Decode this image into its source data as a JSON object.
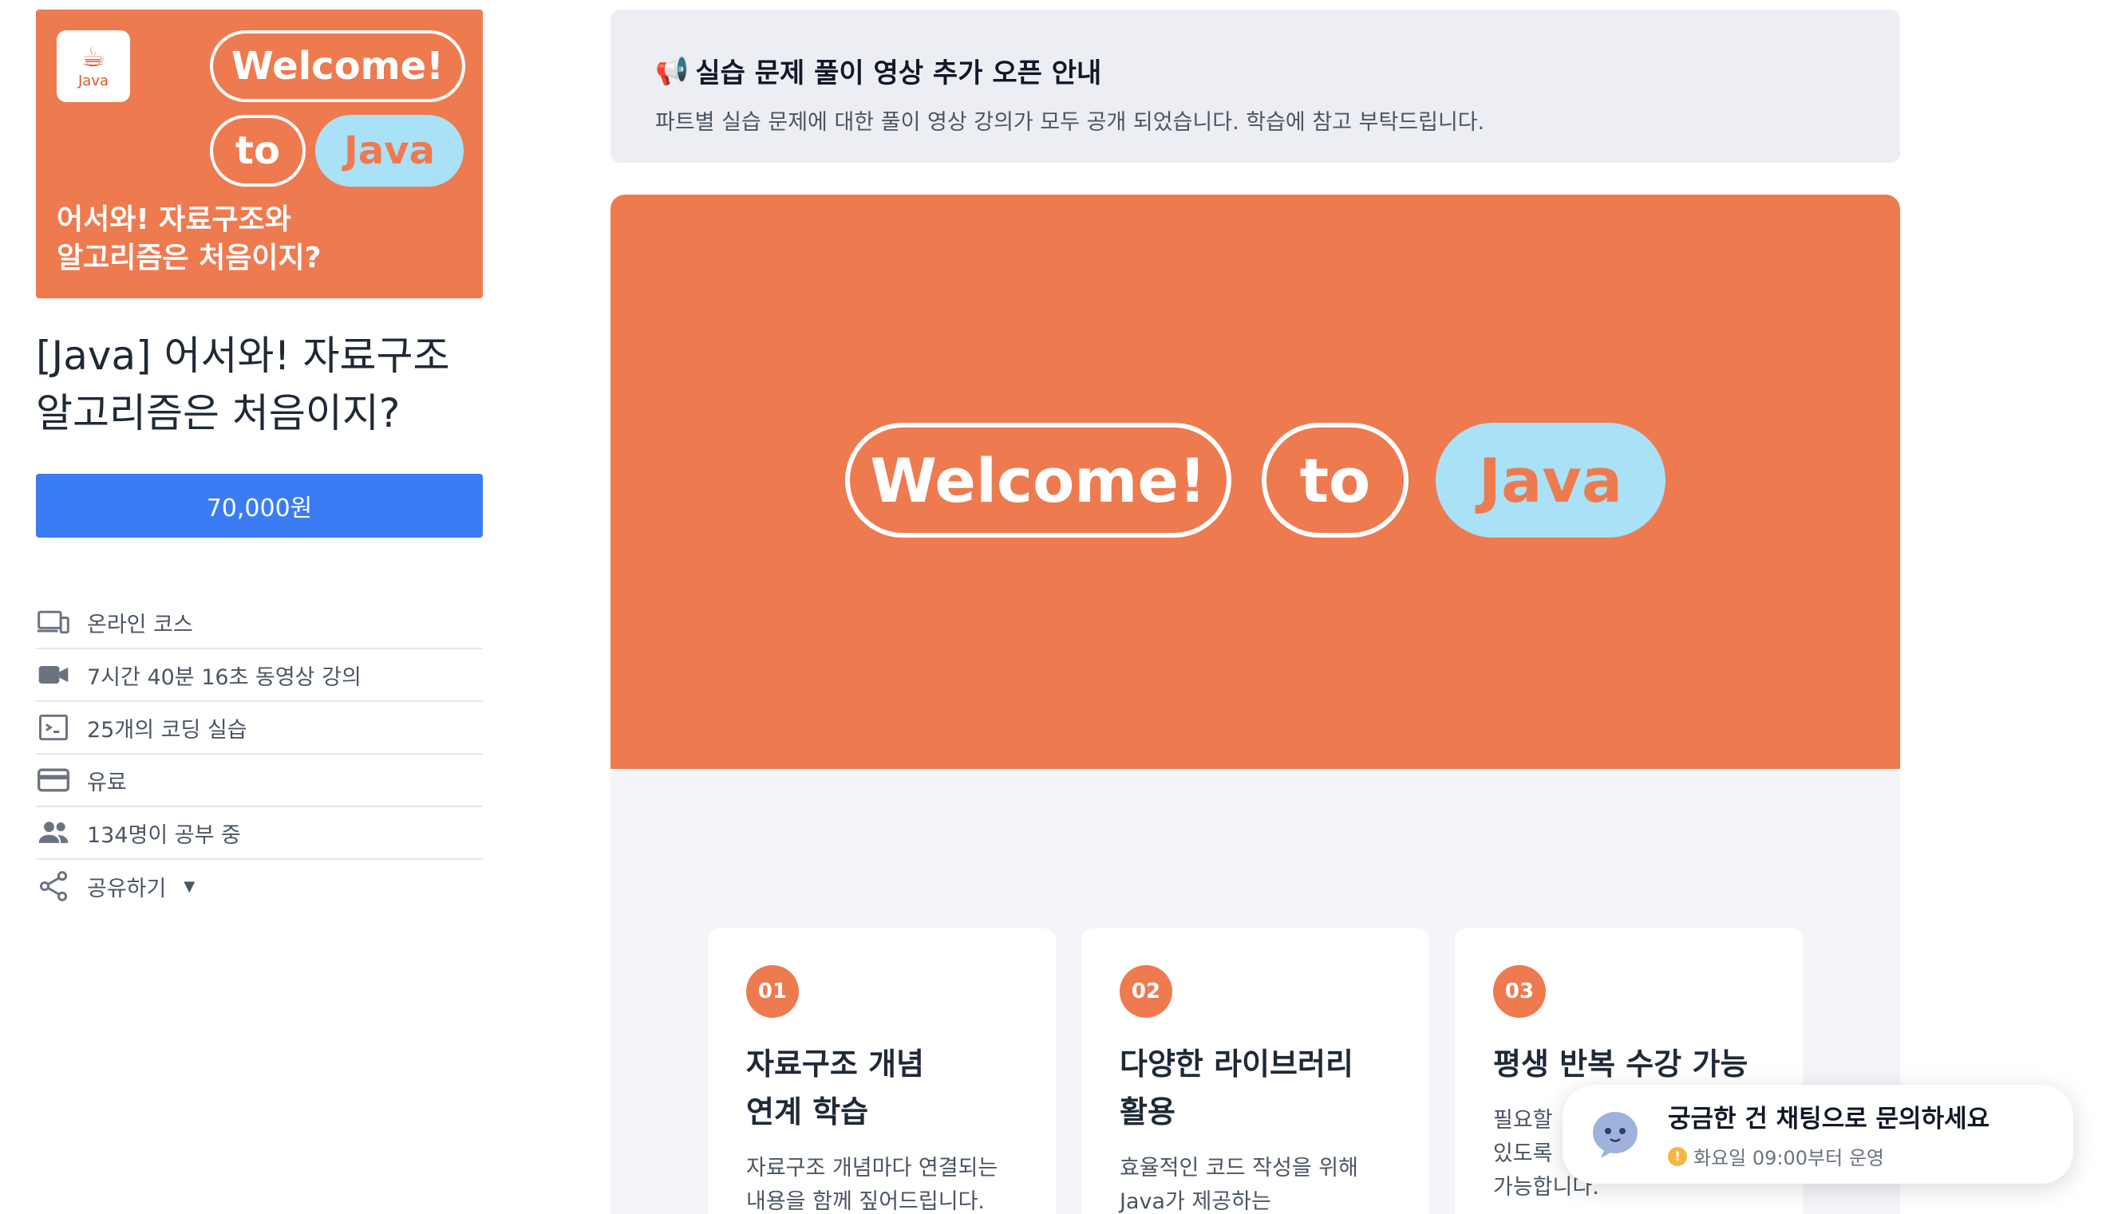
{
  "sidebar": {
    "thumbnail": {
      "logo_text": "Java",
      "bubbles": [
        "Welcome!",
        "to",
        "Java"
      ],
      "caption": "어서와! 자료구조와\n알고리즘은 처음이지?"
    },
    "course_title": "[Java] 어서와! 자료구조\n알고리즘은 처음이지?",
    "price_label": "70,000원",
    "info": [
      {
        "icon": "devices-icon",
        "label": "온라인 코스"
      },
      {
        "icon": "video-camera-icon",
        "label": "7시간 40분 16초 동영상 강의"
      },
      {
        "icon": "terminal-icon",
        "label": "25개의 코딩 실습"
      },
      {
        "icon": "credit-card-icon",
        "label": "유료"
      },
      {
        "icon": "people-icon",
        "label": "134명이 공부 중"
      },
      {
        "icon": "share-icon",
        "label": "공유하기"
      }
    ]
  },
  "notice": {
    "icon": "megaphone-icon",
    "title": "실습 문제 풀이 영상 추가 오픈 안내",
    "text": "파트별 실습 문제에 대한 풀이 영상 강의가 모두 공개 되었습니다. 학습에 참고 부탁드립니다."
  },
  "hero": {
    "bubbles": [
      "Welcome!",
      "to",
      "Java"
    ]
  },
  "features": [
    {
      "num": "01",
      "title": "자료구조 개념\n연계 학습",
      "desc": "자료구조 개념마다 연결되는\n내용을 함께 짚어드립니다."
    },
    {
      "num": "02",
      "title": "다양한 라이브러리\n활용",
      "desc": "효율적인 코드 작성을 위해\nJava가 제공하는"
    },
    {
      "num": "03",
      "title": "평생 반복 수강 가능",
      "desc": "필요할 \n있도록 \n가능합니다."
    }
  ],
  "chat": {
    "title": "궁금한 건 채팅으로 문의하세요",
    "subtitle": "화요일 09:00부터 운영"
  },
  "colors": {
    "brand_orange": "#ee7a50",
    "primary_blue": "#3b7cf4",
    "bubble_blue": "#a9e1f7"
  }
}
